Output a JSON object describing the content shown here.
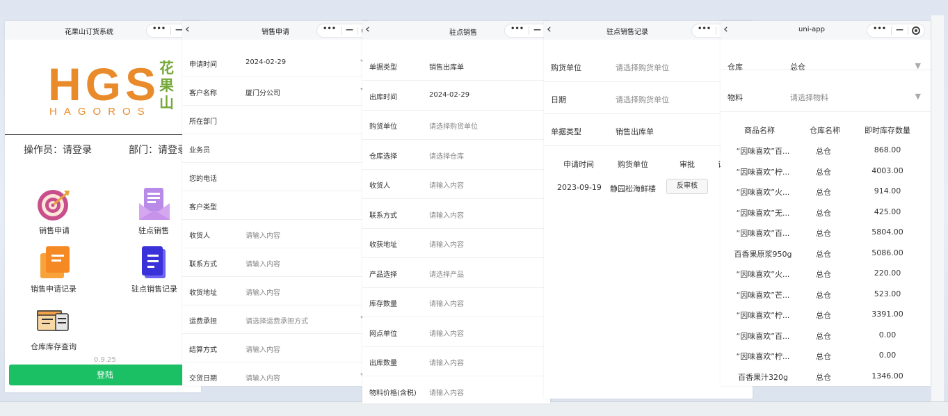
{
  "panel1": {
    "title": "花果山订货系统",
    "logo_main": "HGS",
    "logo_sub": "HAGOROS",
    "logo_cn": "花果山",
    "operator": "操作员：请登录",
    "department": "部门：请登录",
    "menu": [
      {
        "label": "销售申请",
        "icon": "target-icon"
      },
      {
        "label": "驻点销售",
        "icon": "envelope-icon"
      },
      {
        "label": "销售申请记录",
        "icon": "orange-document-icon"
      },
      {
        "label": "驻点销售记录",
        "icon": "blue-document-icon"
      },
      {
        "label": "仓库库存查询",
        "icon": "warehouse-icon"
      }
    ],
    "version": "0.9.25",
    "login": "登陆"
  },
  "panel2": {
    "title": "销售申请",
    "rows": [
      {
        "label": "申请时间",
        "value": "2024-02-29",
        "placeholder": "",
        "arrow": true
      },
      {
        "label": "客户名称",
        "value": "厦门分公司",
        "placeholder": "",
        "arrow": true
      },
      {
        "label": "所在部门",
        "value": "",
        "placeholder": "",
        "arrow": false
      },
      {
        "label": "业务员",
        "value": "",
        "placeholder": "",
        "arrow": false
      },
      {
        "label": "您的电话",
        "value": "",
        "placeholder": "",
        "arrow": false
      },
      {
        "label": "客户类型",
        "value": "",
        "placeholder": "",
        "arrow": false
      },
      {
        "label": "收货人",
        "value": "",
        "placeholder": "请输入内容",
        "arrow": false
      },
      {
        "label": "联系方式",
        "value": "",
        "placeholder": "请输入内容",
        "arrow": false
      },
      {
        "label": "收货地址",
        "value": "",
        "placeholder": "请输入内容",
        "arrow": false
      },
      {
        "label": "运费承担",
        "value": "",
        "placeholder": "请选择运费承担方式",
        "arrow": true
      },
      {
        "label": "结算方式",
        "value": "",
        "placeholder": "请输入内容",
        "arrow": false
      },
      {
        "label": "交货日期",
        "value": "",
        "placeholder": "请输入内容",
        "arrow": true
      }
    ]
  },
  "panel3": {
    "title": "驻点销售",
    "rows": [
      {
        "label": "单据类型",
        "value": "销售出库单",
        "placeholder": ""
      },
      {
        "label": "出库时间",
        "value": "2024-02-29",
        "placeholder": ""
      },
      {
        "label": "购货单位",
        "value": "",
        "placeholder": "请选择购货单位"
      },
      {
        "label": "仓库选择",
        "value": "",
        "placeholder": "请选择仓库"
      },
      {
        "label": "收货人",
        "value": "",
        "placeholder": "请输入内容"
      },
      {
        "label": "联系方式",
        "value": "",
        "placeholder": "请输入内容"
      },
      {
        "label": "收获地址",
        "value": "",
        "placeholder": "请输入内容"
      },
      {
        "label": "产品选择",
        "value": "",
        "placeholder": "请选择产品"
      },
      {
        "label": "库存数量",
        "value": "",
        "placeholder": "请输入内容"
      },
      {
        "label": "网点单位",
        "value": "",
        "placeholder": "请输入内容"
      },
      {
        "label": "出库数量",
        "value": "",
        "placeholder": "请输入内容"
      },
      {
        "label": "物料价格(含税)",
        "value": "",
        "placeholder": "请输入内容"
      }
    ]
  },
  "panel4": {
    "title": "驻点销售记录",
    "rows": [
      {
        "label": "购货单位",
        "value": "",
        "placeholder": "请选择购货单位"
      },
      {
        "label": "日期",
        "value": "",
        "placeholder": "请选择购货单位"
      },
      {
        "label": "单据类型",
        "value": "销售出库单",
        "placeholder": ""
      }
    ],
    "table_headers": [
      "申请时间",
      "购货单位",
      "审批",
      "详"
    ],
    "table_rows": [
      {
        "date": "2023-09-19",
        "unit": "静园松海鲜楼",
        "action": "反审核"
      }
    ]
  },
  "panel5": {
    "title": "uni-app",
    "warehouse_label": "仓库",
    "warehouse_value": "总仓",
    "material_label": "物料",
    "material_placeholder": "请选择物料",
    "table_headers": [
      "商品名称",
      "仓库名称",
      "即时库存数量"
    ],
    "table_rows": [
      {
        "name": "“因味喜欢”百...",
        "warehouse": "总仓",
        "qty": "868.00"
      },
      {
        "name": "“因味喜欢”柠...",
        "warehouse": "总仓",
        "qty": "4003.00"
      },
      {
        "name": "“因味喜欢”火...",
        "warehouse": "总仓",
        "qty": "914.00"
      },
      {
        "name": "“因味喜欢”无...",
        "warehouse": "总仓",
        "qty": "425.00"
      },
      {
        "name": "“因味喜欢”百...",
        "warehouse": "总仓",
        "qty": "5804.00"
      },
      {
        "name": "百香果原浆950g",
        "warehouse": "总仓",
        "qty": "5086.00"
      },
      {
        "name": "“因味喜欢”火...",
        "warehouse": "总仓",
        "qty": "220.00"
      },
      {
        "name": "“因味喜欢”芒...",
        "warehouse": "总仓",
        "qty": "523.00"
      },
      {
        "name": "“因味喜欢”柠...",
        "warehouse": "总仓",
        "qty": "3391.00"
      },
      {
        "name": "“因味喜欢”百...",
        "warehouse": "总仓",
        "qty": "0.00"
      },
      {
        "name": "“因味喜欢”柠...",
        "warehouse": "总仓",
        "qty": "0.00"
      },
      {
        "name": "百香果汁320g",
        "warehouse": "总仓",
        "qty": "1346.00"
      }
    ]
  },
  "colors": {
    "brand_orange": "#e98a2b",
    "brand_green": "#76a83a",
    "login_green": "#1bbf64"
  }
}
